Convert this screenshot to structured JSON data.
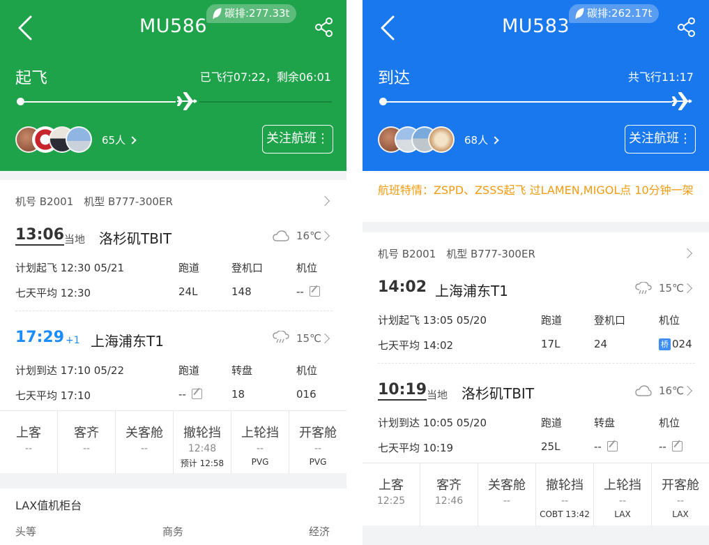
{
  "left": {
    "flight_no": "MU586",
    "carbon": "碳排:277.33t",
    "status": "起飞",
    "elapsed": "已飞行07:22，剩余06:01",
    "progress": 0.53,
    "fans_count": "65人",
    "follow_label": "关注航班",
    "aircraft": "机号 B2001　机型 B777-300ER",
    "dep": {
      "time": "13:06",
      "tag": "当地",
      "airport": "洛杉矶TBIT",
      "weather": "16℃",
      "plan_label": "计划起飞",
      "plan_value": "12:30 05/21",
      "avg_label": "七天平均",
      "avg_value": "12:30",
      "h1": "跑道",
      "h2": "登机口",
      "h3": "机位",
      "v1": "24L",
      "v2": "148",
      "v3": "--"
    },
    "arr": {
      "time": "17:29",
      "plus": "+1",
      "airport": "上海浦东T1",
      "weather": "15℃",
      "plan_label": "计划到达",
      "plan_value": "17:10 05/22",
      "avg_label": "七天平均",
      "avg_value": "17:10",
      "h1": "跑道",
      "h2": "转盘",
      "h3": "机位",
      "v1": "--",
      "v2": "18",
      "v3": "016"
    },
    "nodes": [
      {
        "k": "上客",
        "v": "--",
        "s": ""
      },
      {
        "k": "客齐",
        "v": "--",
        "s": ""
      },
      {
        "k": "关客舱",
        "v": "--",
        "s": ""
      },
      {
        "k": "撤轮挡",
        "v": "12:48",
        "s": "预计 12:58"
      },
      {
        "k": "上轮挡",
        "v": "--",
        "s": "PVG"
      },
      {
        "k": "开客舱",
        "v": "--",
        "s": "PVG"
      }
    ],
    "counter_title": "LAX值机柜台",
    "classes": [
      "头等",
      "商务",
      "经济"
    ]
  },
  "right": {
    "flight_no": "MU583",
    "carbon": "碳排:262.17t",
    "status": "到达",
    "elapsed": "共飞行11:17",
    "progress": 1.0,
    "fans_count": "68人",
    "follow_label": "关注航班",
    "feature": "航班特情：ZSPD、ZSSS起飞 过LAMEN,MIGOL点  10分钟一架",
    "aircraft": "机号 B2001　机型 B777-300ER",
    "dep": {
      "time": "14:02",
      "airport": "上海浦东T1",
      "weather": "15℃",
      "plan_label": "计划起飞",
      "plan_value": "13:05 05/20",
      "avg_label": "七天平均",
      "avg_value": "14:02",
      "h1": "跑道",
      "h2": "登机口",
      "h3": "机位",
      "v1": "17L",
      "v2": "24",
      "bridge": "桥",
      "v3": "024"
    },
    "arr": {
      "time": "10:19",
      "tag": "当地",
      "airport": "洛杉矶TBIT",
      "weather": "16℃",
      "plan_label": "计划到达",
      "plan_value": "10:05 05/20",
      "avg_label": "七天平均",
      "avg_value": "10:19",
      "h1": "跑道",
      "h2": "转盘",
      "h3": "机位",
      "v1": "25L",
      "v2": "--",
      "v3": "--"
    },
    "nodes": [
      {
        "k": "上客",
        "v": "12:25",
        "s": ""
      },
      {
        "k": "客齐",
        "v": "12:46",
        "s": ""
      },
      {
        "k": "关客舱",
        "v": "--",
        "s": ""
      },
      {
        "k": "撤轮挡",
        "v": "--",
        "s": "COBT 13:42"
      },
      {
        "k": "上轮挡",
        "v": "--",
        "s": "LAX"
      },
      {
        "k": "开客舱",
        "v": "--",
        "s": "LAX"
      }
    ]
  },
  "colors": {
    "left_header": "#1fa34a",
    "right_header": "#1a78ee",
    "arrival_time": "#1a8cff",
    "feature_text": "#f39b11"
  }
}
